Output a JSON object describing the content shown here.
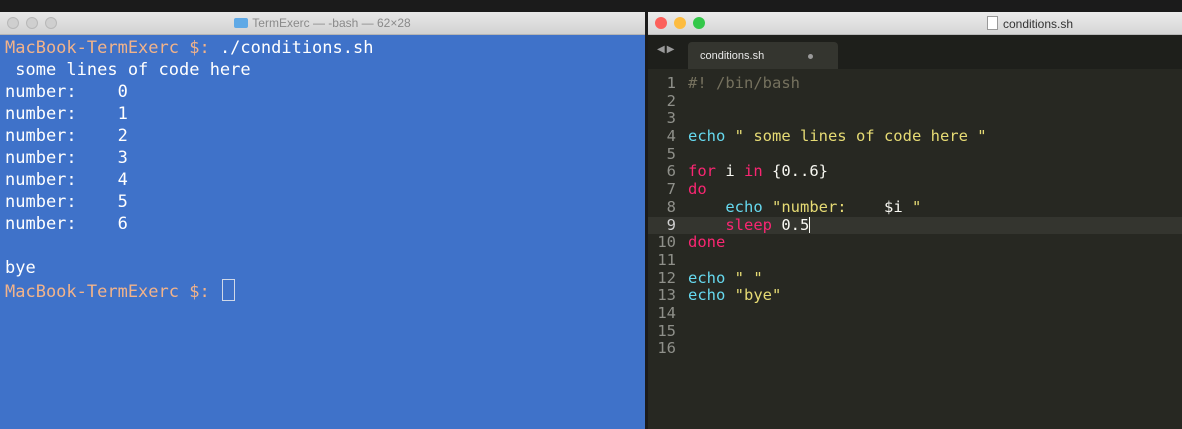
{
  "terminal": {
    "title": "TermExerc — -bash — 62×28",
    "prompt": "MacBook-TermExerc $:",
    "command": " ./conditions.sh",
    "output": [
      " some lines of code here",
      "number:    0",
      "number:    1",
      "number:    2",
      "number:    3",
      "number:    4",
      "number:    5",
      "number:    6",
      "",
      "bye"
    ],
    "final_prompt": "MacBook-TermExerc $:"
  },
  "editor": {
    "title": "conditions.sh",
    "tab_label": "conditions.sh",
    "line_numbers": [
      "1",
      "2",
      "3",
      "4",
      "5",
      "6",
      "7",
      "8",
      "9",
      "10",
      "11",
      "12",
      "13",
      "14",
      "15",
      "16"
    ],
    "code": {
      "l1": "#! /bin/bash",
      "l4_cmd": "echo",
      "l4_str": " \" some lines of code here \"",
      "l6_for": "for",
      "l6_i": " i ",
      "l6_in": "in",
      "l6_range": " {0..6}",
      "l7_do": "do",
      "l8_indent": "    ",
      "l8_cmd": "echo",
      "l8_str1": " \"number:    ",
      "l8_var": "$i",
      "l8_str2": " \"",
      "l9_indent": "    ",
      "l9_cmd": "sleep",
      "l9_arg": " 0.5",
      "l10_done": "done",
      "l12_cmd": "echo",
      "l12_str": " \" \"",
      "l13_cmd": "echo",
      "l13_str": " \"bye\""
    }
  },
  "colors": {
    "terminal_bg": "#3f72c9",
    "prompt": "#f2b38a",
    "editor_bg": "#272822",
    "keyword": "#f92672",
    "builtin": "#66d9ef",
    "string": "#e6db74"
  }
}
